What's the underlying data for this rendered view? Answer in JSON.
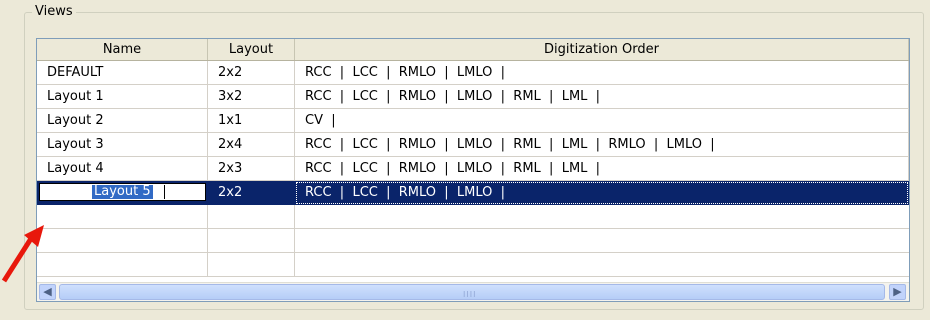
{
  "views": {
    "title": "Views",
    "columns": {
      "name": "Name",
      "layout": "Layout",
      "order": "Digitization Order"
    },
    "rows": [
      {
        "name": "DEFAULT",
        "layout": "2x2",
        "order": "RCC  |  LCC  |  RMLO  |  LMLO  |"
      },
      {
        "name": "Layout 1",
        "layout": "3x2",
        "order": "RCC  |  LCC  |  RMLO  |  LMLO  |  RML  |  LML  |"
      },
      {
        "name": "Layout 2",
        "layout": "1x1",
        "order": "CV  |"
      },
      {
        "name": "Layout 3",
        "layout": "2x4",
        "order": "RCC  |  LCC  |  RMLO  |  LMLO  |  RML  |  LML  |  RMLO  |  LMLO  |"
      },
      {
        "name": "Layout 4",
        "layout": "2x3",
        "order": "RCC  |  LCC  |  RMLO  |  LMLO  |  RML  |  LML  |"
      },
      {
        "name": "Layout 5",
        "layout": "2x2",
        "order": "RCC  |  LCC  |  RMLO  |  LMLO  |",
        "selected": true,
        "editing": true
      }
    ]
  },
  "scrollbar": {
    "left_icon": "scroll-left-icon",
    "right_icon": "scroll-right-icon",
    "left_glyph": "◀",
    "right_glyph": "▶",
    "grip": "IIII"
  },
  "annotation": {
    "icon": "red-arrow-icon",
    "color": "#e8180c"
  },
  "colors": {
    "selection": "#0a246a",
    "header": "#ece9d8",
    "border": "#7f9db9"
  }
}
